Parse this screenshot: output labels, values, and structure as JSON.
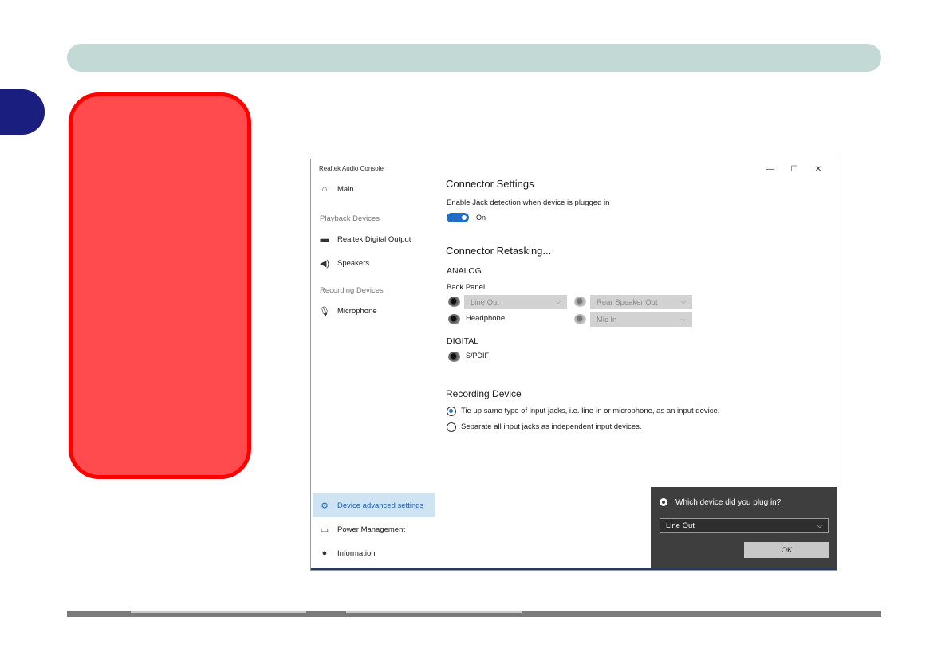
{
  "window": {
    "title": "Realtek Audio Console",
    "controls": [
      "—",
      "☐",
      "✕"
    ]
  },
  "sidebar": {
    "main_label": "Main",
    "playback_section": "Playback Devices",
    "playback_items": [
      "Realtek Digital Output",
      "Speakers"
    ],
    "recording_section": "Recording Devices",
    "recording_items": [
      "Microphone"
    ],
    "bottom_items": [
      "Device advanced settings",
      "Power Management",
      "Information"
    ]
  },
  "connector_settings": {
    "heading": "Connector Settings",
    "jack_detection_label": "Enable Jack detection when device is plugged in",
    "toggle_state": "On"
  },
  "connector_retasking": {
    "heading": "Connector Retasking...",
    "analog_label": "ANALOG",
    "back_panel_label": "Back Panel",
    "line_out_select": "Line Out",
    "rear_speaker_select": "Rear Speaker Out",
    "headphone_label": "Headphone",
    "mic_in_select": "Mic In",
    "digital_label": "DIGITAL",
    "spdif_label": "S/PDIF"
  },
  "recording_device": {
    "heading": "Recording Device",
    "option_tie": "Tie up same type of input jacks, i.e. line-in or microphone, as an input device.",
    "option_separate": "Separate all input jacks as independent input devices.",
    "selected": "tie"
  },
  "popup": {
    "title": "Which device did you plug in?",
    "select_value": "Line Out",
    "ok_label": "OK"
  },
  "colors": {
    "accent": "#1f6fc8",
    "top_bar": "#c2d9d5",
    "chapter_tab": "#1a1e7e",
    "red_panel": "#ff4b4e",
    "red_border": "#ff0000"
  }
}
